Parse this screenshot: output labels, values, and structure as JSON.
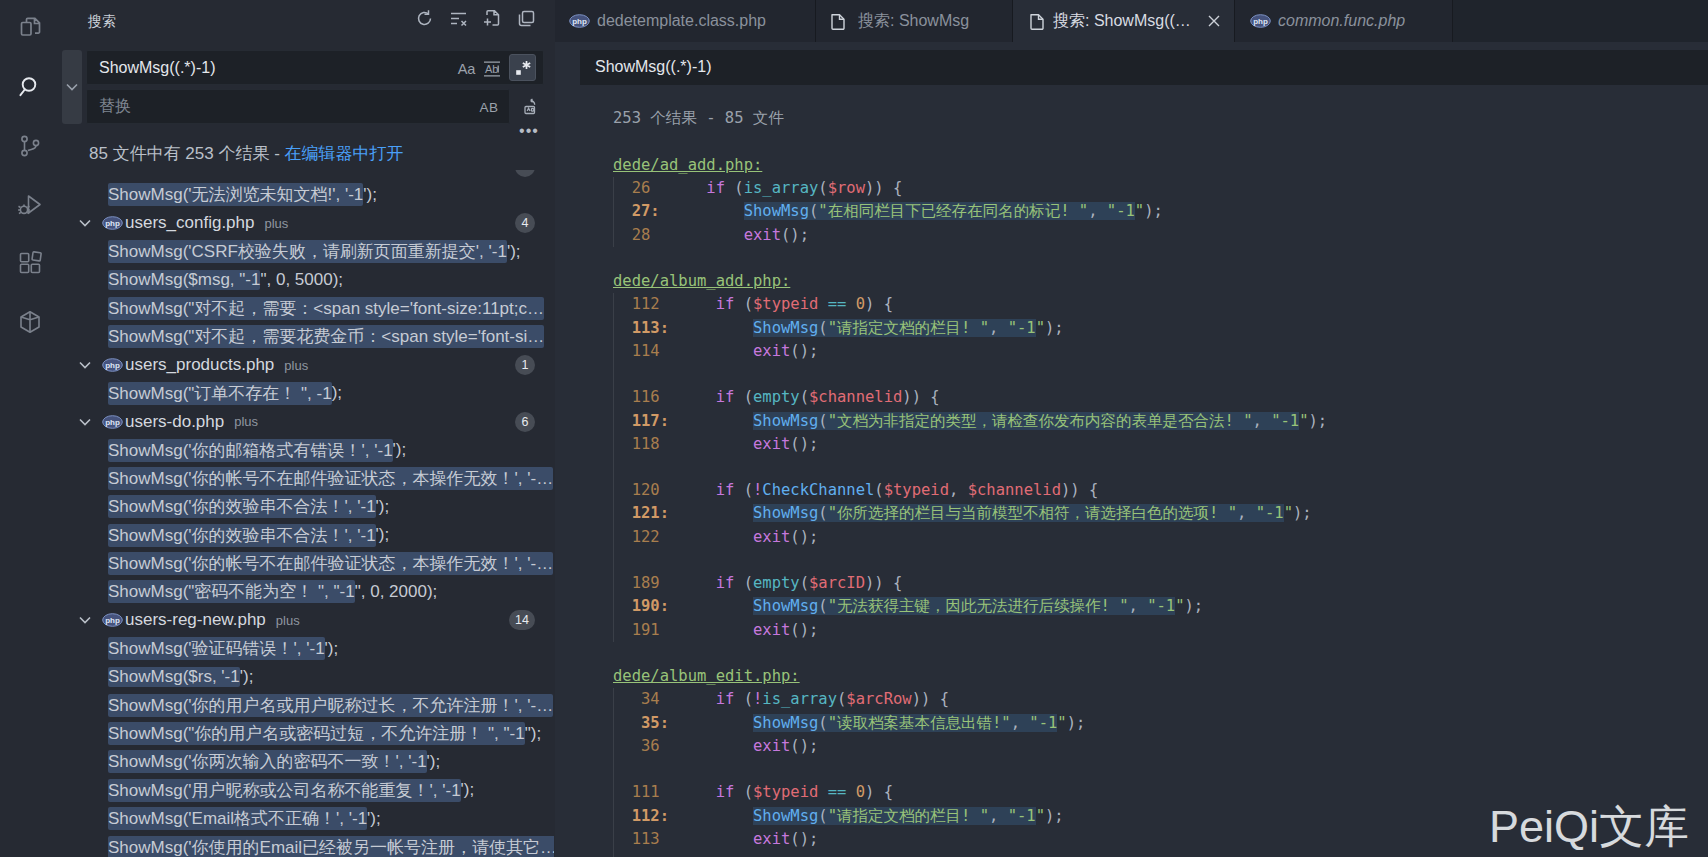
{
  "colors": {
    "editor_bg": "#282d37",
    "sidebar_bg": "#262a33",
    "tabbar_bg": "#1f242c",
    "input_bg": "#1d2127",
    "match_highlight_sidebar": "#3b4c68",
    "match_highlight_editor": "#2e4157",
    "link_blue": "#4aa0f8",
    "keyword": "#c678dd",
    "builtin_function": "#56b6c2",
    "function": "#61afef",
    "variable": "#e06c75",
    "string": "#98c379",
    "number": "#d19a66",
    "punctuation": "#abb2bf",
    "line_number": "#a87e4e",
    "line_number_match": "#d19a66",
    "file_link": "#98c379"
  },
  "activity_bar": {
    "items": [
      {
        "icon": "files-icon",
        "name": "explorer",
        "active": false
      },
      {
        "icon": "search-icon",
        "name": "search",
        "active": true
      },
      {
        "icon": "source-control-icon",
        "name": "source-control",
        "active": false
      },
      {
        "icon": "run-debug-icon",
        "name": "run-and-debug",
        "active": false
      },
      {
        "icon": "extensions-icon",
        "name": "extensions",
        "active": false
      },
      {
        "icon": "package-icon",
        "name": "package-explorer",
        "active": false
      }
    ]
  },
  "sidebar": {
    "title": "搜索",
    "actions": [
      {
        "icon": "refresh-icon",
        "name": "refresh"
      },
      {
        "icon": "clear-icon",
        "name": "clear-search-results"
      },
      {
        "icon": "new-search-editor-icon",
        "name": "open-new-search-editor"
      },
      {
        "icon": "views-icon",
        "name": "view-as-tree"
      }
    ],
    "search": {
      "value": "ShowMsg((.*)-1)",
      "options": [
        {
          "icon": "match-case-icon",
          "label": "Aa",
          "active": false
        },
        {
          "icon": "whole-word-icon",
          "label": "ab",
          "active": false
        },
        {
          "icon": "regex-icon",
          "label": ".*",
          "active": true
        }
      ]
    },
    "replace": {
      "placeholder": "替换",
      "options": [
        {
          "icon": "preserve-case-icon",
          "label": "AB",
          "active": false
        }
      ]
    },
    "summary": {
      "text": "85 文件中有 253 个结果 - ",
      "link": "在编辑器中打开"
    },
    "tree": [
      {
        "kind": "sliver"
      },
      {
        "kind": "match",
        "hl": "ShowMsg('无法浏览未知文档!', '-1",
        "rest": "');"
      },
      {
        "kind": "file",
        "name": "users_config.php",
        "desc": "plus",
        "badge": "4"
      },
      {
        "kind": "match",
        "hl": "ShowMsg('CSRF校验失败，请刷新页面重新提交', '-1",
        "rest": "');"
      },
      {
        "kind": "match",
        "hl": "ShowMsg($msg, \"-1",
        "rest": "\", 0, 5000);"
      },
      {
        "kind": "match",
        "hl": "ShowMsg(\"对不起，需要：<span style='font-size:11pt;c…",
        "rest": ""
      },
      {
        "kind": "match",
        "hl": "ShowMsg(\"对不起，需要花费金币：<span style='font-si…",
        "rest": ""
      },
      {
        "kind": "file",
        "name": "users_products.php",
        "desc": "plus",
        "badge": "1"
      },
      {
        "kind": "match",
        "hl": "ShowMsg(\"订单不存在！ \", -1",
        "rest": ");"
      },
      {
        "kind": "file",
        "name": "users-do.php",
        "desc": "plus",
        "badge": "6"
      },
      {
        "kind": "match",
        "hl": "ShowMsg('你的邮箱格式有错误！', '-1",
        "rest": "');"
      },
      {
        "kind": "match",
        "hl": "ShowMsg('你的帐号不在邮件验证状态，本操作无效！', '-…",
        "rest": ""
      },
      {
        "kind": "match",
        "hl": "ShowMsg('你的效验串不合法！', '-1",
        "rest": "');"
      },
      {
        "kind": "match",
        "hl": "ShowMsg('你的效验串不合法！', '-1",
        "rest": "');"
      },
      {
        "kind": "match",
        "hl": "ShowMsg('你的帐号不在邮件验证状态，本操作无效！', '-…",
        "rest": ""
      },
      {
        "kind": "match",
        "hl": "ShowMsg(\"密码不能为空！ \", \"-1",
        "rest": "\", 0, 2000);"
      },
      {
        "kind": "file",
        "name": "users-reg-new.php",
        "desc": "plus",
        "badge": "14"
      },
      {
        "kind": "match",
        "hl": "ShowMsg('验证码错误！', '-1",
        "rest": "');"
      },
      {
        "kind": "match",
        "hl": "ShowMsg($rs, '-1",
        "rest": "');"
      },
      {
        "kind": "match",
        "hl": "ShowMsg('你的用户名或用户昵称过长，不允许注册！', '-…",
        "rest": ""
      },
      {
        "kind": "match",
        "hl": "ShowMsg(\"你的用户名或密码过短，不允许注册！ \", \"-1",
        "rest": "\");"
      },
      {
        "kind": "match",
        "hl": "ShowMsg('你两次输入的密码不一致！', '-1",
        "rest": "');"
      },
      {
        "kind": "match",
        "hl": "ShowMsg('用户昵称或公司名称不能重复！', '-1",
        "rest": "');"
      },
      {
        "kind": "match",
        "hl": "ShowMsg('Email格式不正确！', '-1",
        "rest": "');"
      },
      {
        "kind": "match",
        "hl": "ShowMsg('你使用的Email已经被另一帐号注册，请使其它…",
        "rest": ""
      }
    ]
  },
  "tabs": [
    {
      "label": "dedetemplate.class.php",
      "icon": "php-icon",
      "active": false,
      "preview": false,
      "closable": false
    },
    {
      "label": "搜索: ShowMsg",
      "icon": "search-editor-icon",
      "active": false,
      "preview": false,
      "closable": false
    },
    {
      "label": "搜索: ShowMsg((…",
      "icon": "search-editor-icon",
      "active": true,
      "preview": false,
      "closable": true
    },
    {
      "label": "common.func.php",
      "icon": "php-icon",
      "active": false,
      "preview": true,
      "closable": false
    }
  ],
  "editor": {
    "query": "ShowMsg((.*)-1)",
    "rows": [
      {
        "t": "summary",
        "text": "253 个结果 - 85 文件"
      },
      {
        "t": "blank"
      },
      {
        "t": "head",
        "text": "dede/ad_add.php:"
      },
      {
        "t": "code",
        "n": "26",
        "pad": 2,
        "match": false,
        "segs": [
          [
            "p",
            "    "
          ],
          [
            "kw",
            "if"
          ],
          [
            "p",
            " ("
          ],
          [
            "fb",
            "is_array"
          ],
          [
            "p",
            "("
          ],
          [
            "v",
            "$row"
          ],
          [
            "p",
            ")) {"
          ]
        ]
      },
      {
        "t": "code",
        "n": "27",
        "pad": 2,
        "match": true,
        "segs": [
          [
            "p",
            "        "
          ],
          [
            "fn",
            "ShowMsg",
            1
          ],
          [
            "p",
            "(",
            1
          ],
          [
            "s",
            "\"在相同栏目下已经存在同名的标记! \"",
            1
          ],
          [
            "p",
            ", ",
            1
          ],
          [
            "s",
            "\"-1",
            1
          ],
          [
            "s",
            "\""
          ],
          [
            "p",
            ");"
          ]
        ]
      },
      {
        "t": "code",
        "n": "28",
        "pad": 2,
        "match": false,
        "segs": [
          [
            "p",
            "        "
          ],
          [
            "kw",
            "exit"
          ],
          [
            "p",
            "();"
          ]
        ]
      },
      {
        "t": "blank"
      },
      {
        "t": "head",
        "text": "dede/album_add.php:"
      },
      {
        "t": "code",
        "n": "112",
        "pad": 3,
        "match": false,
        "segs": [
          [
            "p",
            "    "
          ],
          [
            "kw",
            "if"
          ],
          [
            "p",
            " ("
          ],
          [
            "v",
            "$typeid"
          ],
          [
            "p",
            " "
          ],
          [
            "fb",
            "=="
          ],
          [
            "p",
            " "
          ],
          [
            "n2",
            "0"
          ],
          [
            "p",
            ") {"
          ]
        ]
      },
      {
        "t": "code",
        "n": "113",
        "pad": 3,
        "match": true,
        "segs": [
          [
            "p",
            "        "
          ],
          [
            "fn",
            "ShowMsg",
            1
          ],
          [
            "p",
            "(",
            1
          ],
          [
            "s",
            "\"请指定文档的栏目! \"",
            1
          ],
          [
            "p",
            ", ",
            1
          ],
          [
            "s",
            "\"-1",
            1
          ],
          [
            "s",
            "\""
          ],
          [
            "p",
            ");"
          ]
        ]
      },
      {
        "t": "code",
        "n": "114",
        "pad": 3,
        "match": false,
        "segs": [
          [
            "p",
            "        "
          ],
          [
            "kw",
            "exit"
          ],
          [
            "p",
            "();"
          ]
        ]
      },
      {
        "t": "blank"
      },
      {
        "t": "code",
        "n": "116",
        "pad": 3,
        "match": false,
        "segs": [
          [
            "p",
            "    "
          ],
          [
            "kw",
            "if"
          ],
          [
            "p",
            " ("
          ],
          [
            "fb",
            "empty"
          ],
          [
            "p",
            "("
          ],
          [
            "v",
            "$channelid"
          ],
          [
            "p",
            ")) {"
          ]
        ]
      },
      {
        "t": "code",
        "n": "117",
        "pad": 3,
        "match": true,
        "segs": [
          [
            "p",
            "        "
          ],
          [
            "fn",
            "ShowMsg",
            1
          ],
          [
            "p",
            "(",
            1
          ],
          [
            "s",
            "\"文档为非指定的类型，请检查你发布内容的表单是否合法! \"",
            1
          ],
          [
            "p",
            ", ",
            1
          ],
          [
            "s",
            "\"-1",
            1
          ],
          [
            "s",
            "\""
          ],
          [
            "p",
            ");"
          ]
        ]
      },
      {
        "t": "code",
        "n": "118",
        "pad": 3,
        "match": false,
        "segs": [
          [
            "p",
            "        "
          ],
          [
            "kw",
            "exit"
          ],
          [
            "p",
            "();"
          ]
        ]
      },
      {
        "t": "blank"
      },
      {
        "t": "code",
        "n": "120",
        "pad": 3,
        "match": false,
        "segs": [
          [
            "p",
            "    "
          ],
          [
            "kw",
            "if"
          ],
          [
            "p",
            " ("
          ],
          [
            "kw",
            "!"
          ],
          [
            "fn",
            "CheckChannel"
          ],
          [
            "p",
            "("
          ],
          [
            "v",
            "$typeid"
          ],
          [
            "p",
            ", "
          ],
          [
            "v",
            "$channelid"
          ],
          [
            "p",
            ")) {"
          ]
        ]
      },
      {
        "t": "code",
        "n": "121",
        "pad": 3,
        "match": true,
        "segs": [
          [
            "p",
            "        "
          ],
          [
            "fn",
            "ShowMsg",
            1
          ],
          [
            "p",
            "(",
            1
          ],
          [
            "s",
            "\"你所选择的栏目与当前模型不相符，请选择白色的选项! \"",
            1
          ],
          [
            "p",
            ", ",
            1
          ],
          [
            "s",
            "\"-1",
            1
          ],
          [
            "s",
            "\""
          ],
          [
            "p",
            ");"
          ]
        ]
      },
      {
        "t": "code",
        "n": "122",
        "pad": 3,
        "match": false,
        "segs": [
          [
            "p",
            "        "
          ],
          [
            "kw",
            "exit"
          ],
          [
            "p",
            "();"
          ]
        ]
      },
      {
        "t": "blank"
      },
      {
        "t": "code",
        "n": "189",
        "pad": 3,
        "match": false,
        "segs": [
          [
            "p",
            "    "
          ],
          [
            "kw",
            "if"
          ],
          [
            "p",
            " ("
          ],
          [
            "fb",
            "empty"
          ],
          [
            "p",
            "("
          ],
          [
            "v",
            "$arcID"
          ],
          [
            "p",
            ")) {"
          ]
        ]
      },
      {
        "t": "code",
        "n": "190",
        "pad": 3,
        "match": true,
        "segs": [
          [
            "p",
            "        "
          ],
          [
            "fn",
            "ShowMsg",
            1
          ],
          [
            "p",
            "(",
            1
          ],
          [
            "s",
            "\"无法获得主键，因此无法进行后续操作! \"",
            1
          ],
          [
            "p",
            ", ",
            1
          ],
          [
            "s",
            "\"-1",
            1
          ],
          [
            "s",
            "\""
          ],
          [
            "p",
            ");"
          ]
        ]
      },
      {
        "t": "code",
        "n": "191",
        "pad": 3,
        "match": false,
        "segs": [
          [
            "p",
            "        "
          ],
          [
            "kw",
            "exit"
          ],
          [
            "p",
            "();"
          ]
        ]
      },
      {
        "t": "blank"
      },
      {
        "t": "head",
        "text": "dede/album_edit.php:"
      },
      {
        "t": "code",
        "n": "34",
        "pad": 3,
        "match": false,
        "segs": [
          [
            "p",
            "    "
          ],
          [
            "kw",
            "if"
          ],
          [
            "p",
            " ("
          ],
          [
            "kw",
            "!"
          ],
          [
            "fb",
            "is_array"
          ],
          [
            "p",
            "("
          ],
          [
            "v",
            "$arcRow"
          ],
          [
            "p",
            ")) {"
          ]
        ]
      },
      {
        "t": "code",
        "n": "35",
        "pad": 3,
        "match": true,
        "segs": [
          [
            "p",
            "        "
          ],
          [
            "fn",
            "ShowMsg",
            1
          ],
          [
            "p",
            "(",
            1
          ],
          [
            "s",
            "\"读取档案基本信息出错!\"",
            1
          ],
          [
            "p",
            ", ",
            1
          ],
          [
            "s",
            "\"-1",
            1
          ],
          [
            "s",
            "\""
          ],
          [
            "p",
            ");"
          ]
        ]
      },
      {
        "t": "code",
        "n": "36",
        "pad": 3,
        "match": false,
        "segs": [
          [
            "p",
            "        "
          ],
          [
            "kw",
            "exit"
          ],
          [
            "p",
            "();"
          ]
        ]
      },
      {
        "t": "blank"
      },
      {
        "t": "code",
        "n": "111",
        "pad": 3,
        "match": false,
        "segs": [
          [
            "p",
            "    "
          ],
          [
            "kw",
            "if"
          ],
          [
            "p",
            " ("
          ],
          [
            "v",
            "$typeid"
          ],
          [
            "p",
            " "
          ],
          [
            "fb",
            "=="
          ],
          [
            "p",
            " "
          ],
          [
            "n2",
            "0"
          ],
          [
            "p",
            ") {"
          ]
        ]
      },
      {
        "t": "code",
        "n": "112",
        "pad": 3,
        "match": true,
        "segs": [
          [
            "p",
            "        "
          ],
          [
            "fn",
            "ShowMsg",
            1
          ],
          [
            "p",
            "(",
            1
          ],
          [
            "s",
            "\"请指定文档的栏目! \"",
            1
          ],
          [
            "p",
            ", ",
            1
          ],
          [
            "s",
            "\"-1",
            1
          ],
          [
            "s",
            "\""
          ],
          [
            "p",
            ");"
          ]
        ]
      },
      {
        "t": "code",
        "n": "113",
        "pad": 3,
        "match": false,
        "segs": [
          [
            "p",
            "        "
          ],
          [
            "kw",
            "exit"
          ],
          [
            "p",
            "();"
          ]
        ]
      }
    ],
    "guides": [
      {
        "from": 3,
        "to": 5,
        "extend": false
      },
      {
        "from": 8,
        "to": 22,
        "extend": false
      },
      {
        "from": 25,
        "to": 31,
        "extend": true
      }
    ]
  },
  "watermark": "PeiQi文库"
}
